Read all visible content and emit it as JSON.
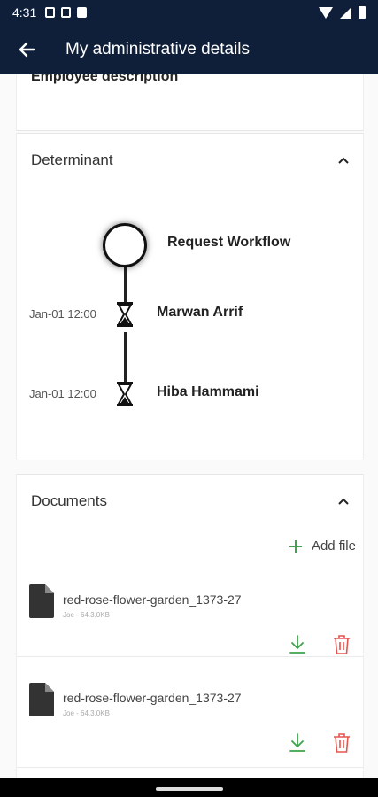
{
  "status_bar": {
    "time": "4:31",
    "icons": [
      "notification-a-icon",
      "notification-box-icon",
      "sd-card-icon",
      "wifi-icon",
      "signal-icon",
      "battery-icon"
    ]
  },
  "app_bar": {
    "title": "My administrative details",
    "back_icon": "arrow-left-icon",
    "background": "#0f1f3a"
  },
  "employee_section": {
    "title": "Employee description"
  },
  "determinant_section": {
    "title": "Determinant",
    "expanded": true,
    "workflow": {
      "start_label": "Request Workflow",
      "steps": [
        {
          "date": "Jan-01 12:00",
          "name": "Marwan Arrif",
          "icon": "hourglass-icon"
        },
        {
          "date": "Jan-01 12:00",
          "name": "Hiba Hammami",
          "icon": "hourglass-icon"
        }
      ]
    }
  },
  "documents_section": {
    "title": "Documents",
    "expanded": true,
    "add_file_label": "Add file",
    "accent_add": "#3ea34a",
    "accent_delete": "#e5554f",
    "files": [
      {
        "name": "red-rose-flower-garden_1373-27",
        "meta": "Joe - 64.3.0KB"
      },
      {
        "name": "red-rose-flower-garden_1373-27",
        "meta": "Joe - 64.3.0KB"
      }
    ]
  }
}
